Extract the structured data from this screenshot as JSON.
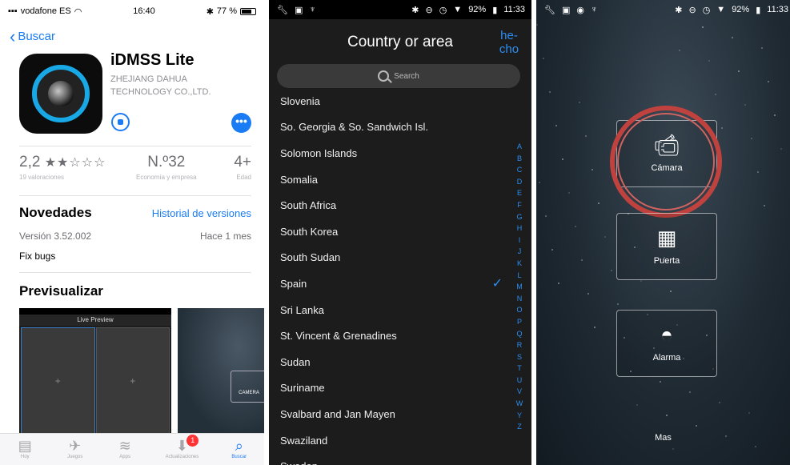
{
  "app_store": {
    "status_bar": {
      "carrier": "vodafone ES",
      "time": "16:40",
      "battery": "77 %",
      "battery_level": 0.77
    },
    "back_label": "Buscar",
    "app": {
      "name": "iDMSS Lite",
      "developer": "ZHEJIANG DAHUA TECHNOLOGY CO.,LTD."
    },
    "stats": {
      "rating": {
        "value": "2,2",
        "stars": "★★☆☆☆",
        "caption": "19 valoraciones"
      },
      "rank": {
        "value": "N.º32",
        "caption": "Economía y empresa"
      },
      "age": {
        "value": "4+",
        "caption": "Edad"
      }
    },
    "whats_new": {
      "title": "Novedades",
      "history_link": "Historial de versiones",
      "version": "Versión 3.52.002",
      "ago": "Hace 1 mes",
      "notes": "Fix bugs"
    },
    "preview": {
      "title": "Previsualizar",
      "shot_title": "Live Preview",
      "shot2_label": "CAMERA"
    },
    "tabs": [
      {
        "label": "Hoy",
        "icon": "today-icon"
      },
      {
        "label": "Juegos",
        "icon": "rocket-icon"
      },
      {
        "label": "Apps",
        "icon": "layers-icon"
      },
      {
        "label": "Actualizaciones",
        "icon": "download-icon",
        "badge": "1"
      },
      {
        "label": "Buscar",
        "icon": "search-icon",
        "active": true
      }
    ],
    "accent_color": "#1a7cf5"
  },
  "country_picker": {
    "status_bar": {
      "battery": "92%",
      "time": "11:33"
    },
    "title": "Country or area",
    "done_label": "he-\ncho",
    "search_placeholder": "Search",
    "countries": [
      "Slovenia",
      "So. Georgia & So. Sandwich Isl.",
      "Solomon Islands",
      "Somalia",
      "South Africa",
      "South Korea",
      "South Sudan",
      "Spain",
      "Sri Lanka",
      "St. Vincent & Grenadines",
      "Sudan",
      "Suriname",
      "Svalbard and Jan Mayen",
      "Swaziland",
      "Sweden"
    ],
    "selected": "Spain",
    "index_letters": [
      "A",
      "B",
      "C",
      "D",
      "E",
      "F",
      "G",
      "H",
      "I",
      "J",
      "K",
      "L",
      "M",
      "N",
      "O",
      "P",
      "Q",
      "R",
      "S",
      "T",
      "U",
      "V",
      "W",
      "Y",
      "Z"
    ],
    "accent_color": "#2b8ef2"
  },
  "home": {
    "status_bar": {
      "battery": "92%",
      "time": "11:33"
    },
    "tiles": [
      {
        "label": "Cámara",
        "icon": "camera-icon"
      },
      {
        "label": "Puerta",
        "icon": "door-intercom-icon"
      },
      {
        "label": "Alarma",
        "icon": "alarm-icon"
      }
    ],
    "more_label": "Mas",
    "highlight_color": "#c0423f"
  }
}
